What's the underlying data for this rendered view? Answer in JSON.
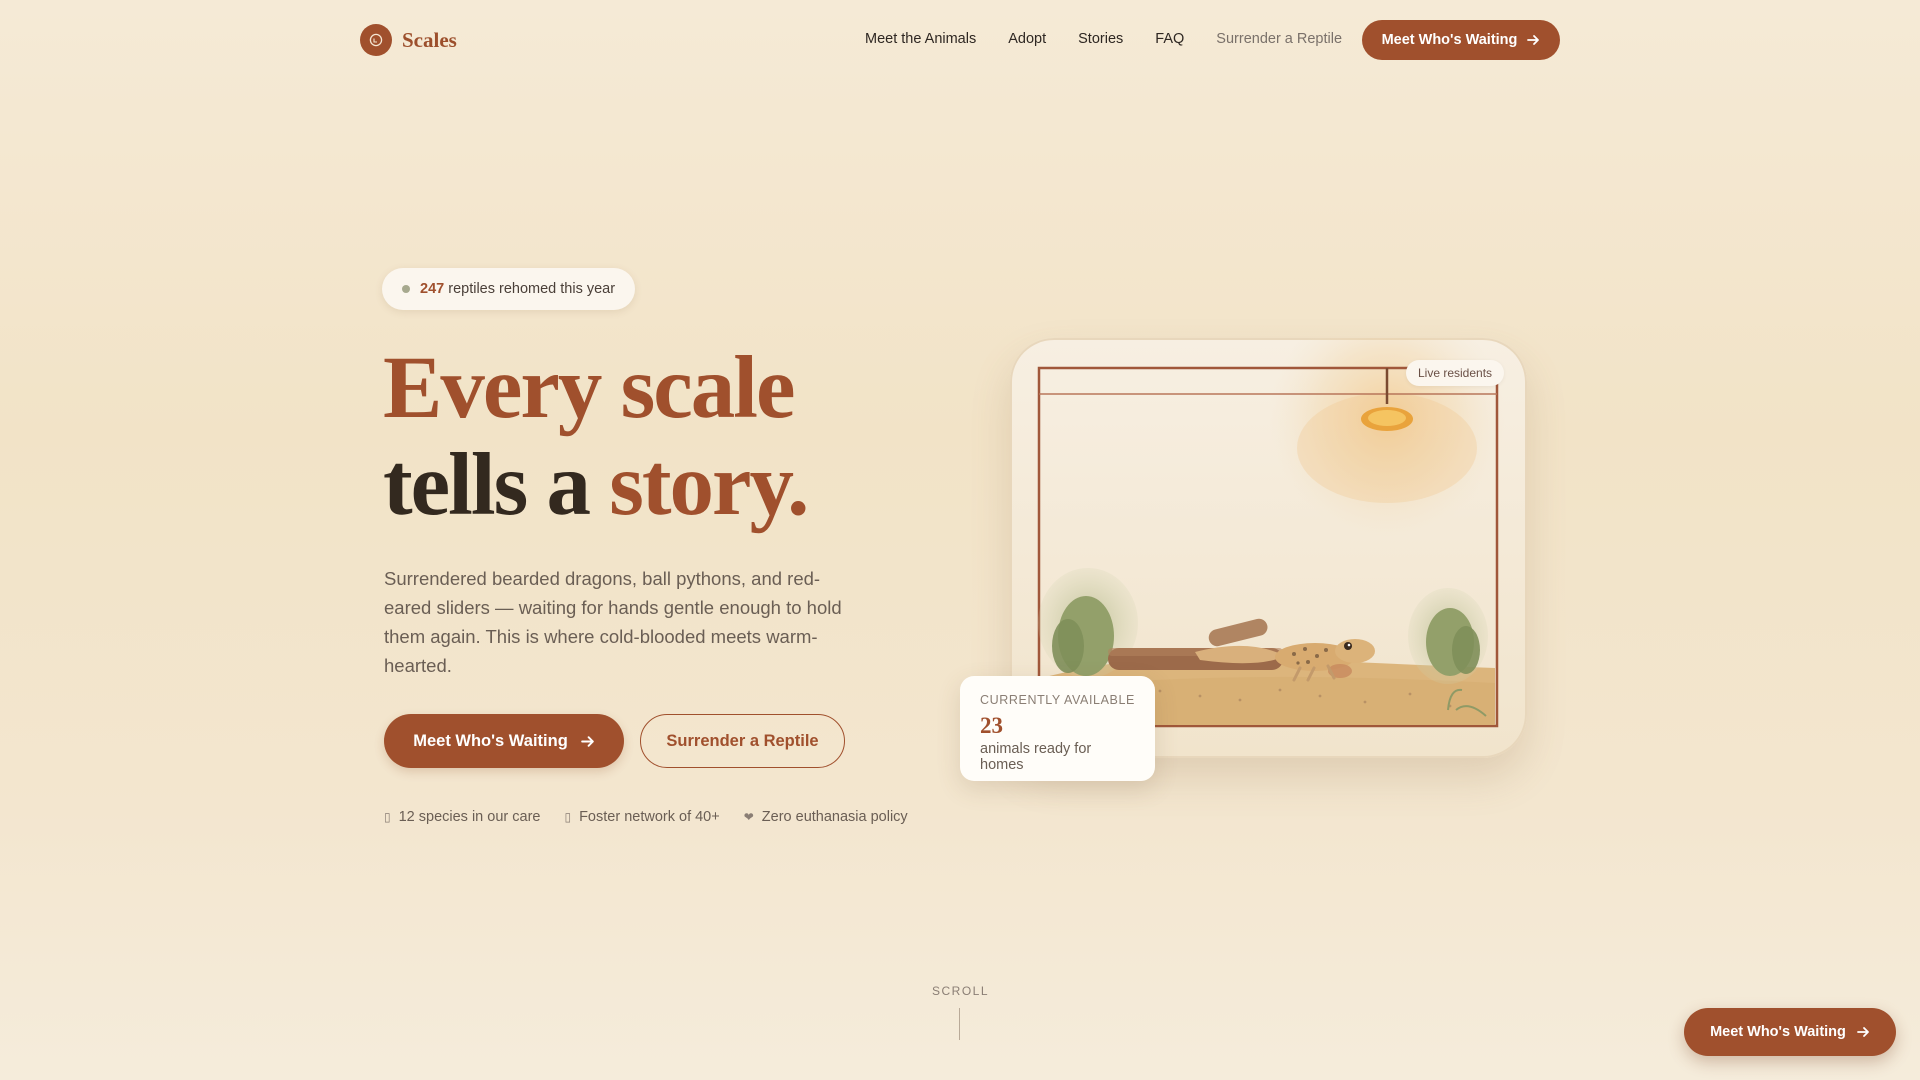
{
  "brand": {
    "name": "Scales"
  },
  "nav": {
    "links": [
      "Meet the Animals",
      "Adopt",
      "Stories",
      "FAQ",
      "Surrender a Reptile"
    ],
    "cta_label": "Meet Who's Waiting"
  },
  "hero": {
    "pill_count": "247",
    "pill_text": "reptiles rehomed this year",
    "headline_line1": "Every scale",
    "headline_line2a": "tells a ",
    "headline_line2b": "story.",
    "lede": "Surrendered bearded dragons, ball pythons, and red-eared sliders — waiting for hands gentle enough to hold them again. This is where cold-blooded meets warm-hearted.",
    "primary_cta": "Meet Who's Waiting",
    "secondary_cta": "Surrender a Reptile",
    "facts": [
      "12 species in our care",
      "Foster network of 40+",
      "Zero euthanasia policy"
    ]
  },
  "terrarium": {
    "badge": "Live residents",
    "available_label": "CURRENTLY AVAILABLE",
    "available_count": "23",
    "available_sub": "animals ready for homes"
  },
  "scroll_label": "SCROLL",
  "floating_cta": "Meet Who's Waiting",
  "colors": {
    "accent": "#a0502d",
    "text": "#33291f",
    "background": "#f3e6cf"
  },
  "icons": [
    "logo-icon",
    "arrow-right-icon",
    "dot-icon",
    "species-icon",
    "foster-icon",
    "heart-icon"
  ]
}
